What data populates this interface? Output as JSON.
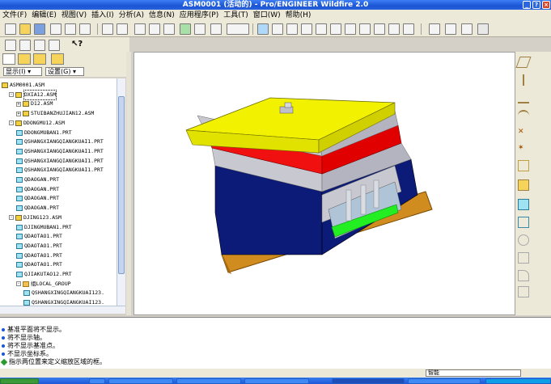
{
  "window": {
    "title": "ASM0001 (活动的) - Pro/ENGINEER Wildfire 2.0"
  },
  "menu": [
    "文件(F)",
    "编辑(E)",
    "视图(V)",
    "插入(I)",
    "分析(A)",
    "信息(N)",
    "应用程序(P)",
    "工具(T)",
    "窗口(W)",
    "帮助(H)"
  ],
  "nav": {
    "show_label": "显示(I) ▾",
    "settings_label": "设置(G) ▾"
  },
  "tree": [
    {
      "label": "ASM0001.ASM",
      "type": "asm",
      "indent": 0,
      "toggle": ""
    },
    {
      "label": "DXIA12.ASM",
      "type": "asm",
      "indent": 1,
      "toggle": "-"
    },
    {
      "label": "D12.ASM",
      "type": "asm",
      "indent": 2,
      "toggle": "+"
    },
    {
      "label": "STUIBANZHUJIAN12.ASM",
      "type": "asm",
      "indent": 2,
      "toggle": "+"
    },
    {
      "label": "DDONGMU12.ASM",
      "type": "asm",
      "indent": 1,
      "toggle": "-"
    },
    {
      "label": "DDONGMUBAN1.PRT",
      "type": "part",
      "indent": 2,
      "toggle": ""
    },
    {
      "label": "QSHANGXIANGQIANGKUAI1.PRT",
      "type": "part",
      "indent": 2,
      "toggle": ""
    },
    {
      "label": "QSHANGXIANGQIANGKUAI1.PRT",
      "type": "part",
      "indent": 2,
      "toggle": ""
    },
    {
      "label": "QSHANGXIANGQIANGKUAI1.PRT",
      "type": "part",
      "indent": 2,
      "toggle": ""
    },
    {
      "label": "QSHANGXIANGQIANGKUAI1.PRT",
      "type": "part",
      "indent": 2,
      "toggle": ""
    },
    {
      "label": "QDAOGAN.PRT",
      "type": "part",
      "indent": 2,
      "toggle": ""
    },
    {
      "label": "QDAOGAN.PRT",
      "type": "part",
      "indent": 2,
      "toggle": ""
    },
    {
      "label": "QDAOGAN.PRT",
      "type": "part",
      "indent": 2,
      "toggle": ""
    },
    {
      "label": "QDAOGAN.PRT",
      "type": "part",
      "indent": 2,
      "toggle": ""
    },
    {
      "label": "DJING123.ASM",
      "type": "asm",
      "indent": 1,
      "toggle": "-"
    },
    {
      "label": "DJINGMUBAN1.PRT",
      "type": "part",
      "indent": 2,
      "toggle": ""
    },
    {
      "label": "QDAOTAO1.PRT",
      "type": "part",
      "indent": 2,
      "toggle": ""
    },
    {
      "label": "QDAOTAO1.PRT",
      "type": "part",
      "indent": 2,
      "toggle": ""
    },
    {
      "label": "QDAOTAO1.PRT",
      "type": "part",
      "indent": 2,
      "toggle": ""
    },
    {
      "label": "QDAOTAO1.PRT",
      "type": "part",
      "indent": 2,
      "toggle": ""
    },
    {
      "label": "QJIAKUTAO12.PRT",
      "type": "part",
      "indent": 2,
      "toggle": ""
    },
    {
      "label": "组LOCAL_GROUP",
      "type": "grp",
      "indent": 2,
      "toggle": "-"
    },
    {
      "label": "QSHANGXINGQIANGKUAI123.",
      "type": "part",
      "indent": 3,
      "toggle": ""
    },
    {
      "label": "QSHANGXINGQIANGKUAI123.",
      "type": "part",
      "indent": 3,
      "toggle": ""
    }
  ],
  "messages": [
    {
      "text": "基准平面将不显示。",
      "kind": "info"
    },
    {
      "text": "将不显示轴。",
      "kind": "info"
    },
    {
      "text": "将不显示基准点。",
      "kind": "info"
    },
    {
      "text": "不显示坐标系。",
      "kind": "info"
    },
    {
      "text": "指示两位置来定义缩放区域的框。",
      "kind": "prompt"
    }
  ],
  "status": {
    "filter_value": "智能"
  },
  "colors": {
    "plate_yellow": "#f2f200",
    "plate_red": "#f01010",
    "plate_gray": "#c8c8d0",
    "plate_navy": "#0c1a78",
    "plate_orange": "#d08c1e",
    "core_green": "#22ee22",
    "titlebar_blue": "#1b55d4"
  }
}
